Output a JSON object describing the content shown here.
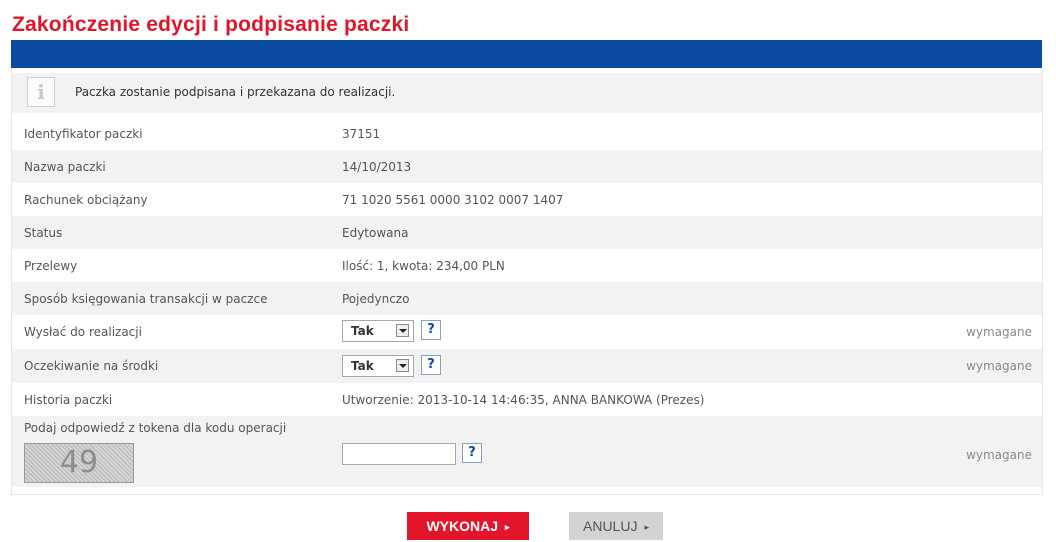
{
  "page": {
    "title": "Zakończenie edycji i podpisanie paczki"
  },
  "info": {
    "icon": "info-icon",
    "glyph": "i",
    "text": "Paczka zostanie podpisana i przekazana do realizacji."
  },
  "details": [
    {
      "label": "Identyfikator paczki",
      "value": "37151"
    },
    {
      "label": "Nazwa paczki",
      "value": "14/10/2013"
    },
    {
      "label": "Rachunek obciążany",
      "value": "71 1020 5561 0000 3102 0007 1407"
    },
    {
      "label": "Status",
      "value": "Edytowana"
    },
    {
      "label": "Przelewy",
      "value": "Ilość: 1, kwota: 234,00 PLN"
    },
    {
      "label": "Sposób księgowania transakcji w paczce",
      "value": "Pojedynczo"
    }
  ],
  "send_for_execution": {
    "label": "Wysłać do realizacji",
    "selected": "Tak",
    "help": "?",
    "required": "wymagane"
  },
  "wait_for_funds": {
    "label": "Oczekiwanie na środki",
    "selected": "Tak",
    "help": "?",
    "required": "wymagane"
  },
  "history": {
    "label": "Historia paczki",
    "value": "Utworzenie: 2013-10-14 14:46:35, ANNA BANKOWA (Prezes)"
  },
  "token": {
    "label": "Podaj odpowiedź z tokena dla kodu operacji",
    "code": "49",
    "value": "",
    "help": "?",
    "required": "wymagane"
  },
  "actions": {
    "execute_label": "WYKONAJ",
    "cancel_label": "ANULUJ",
    "arrow_glyph": "▸"
  },
  "colors": {
    "accent": "#e3152b",
    "header_bar": "#0a4aa0",
    "row_shade": "#f2f2f2"
  }
}
